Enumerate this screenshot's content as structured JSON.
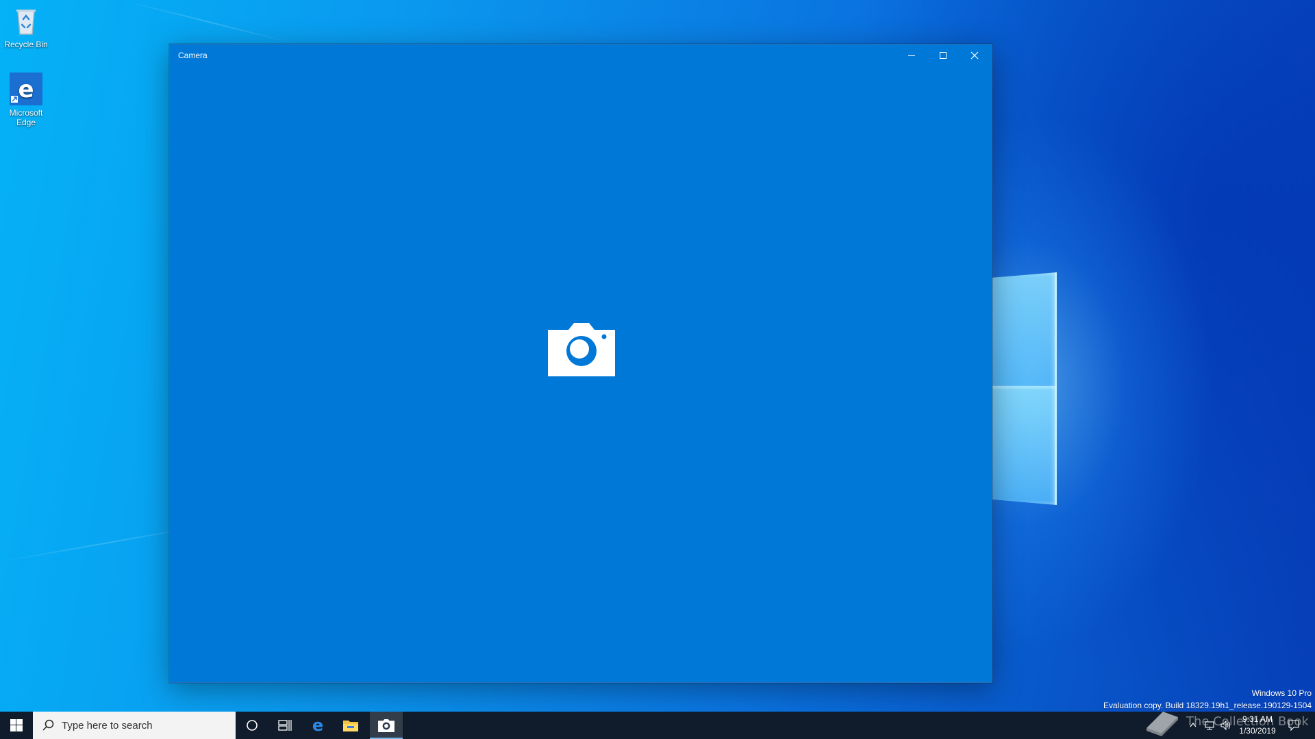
{
  "desktop": {
    "icons": [
      {
        "label": "Recycle Bin",
        "icon": "recycle-bin-icon"
      },
      {
        "label": "Microsoft Edge",
        "icon": "edge-icon"
      }
    ],
    "edition": "Windows 10 Pro",
    "build": "Evaluation copy. Build 18329.19h1_release.190129-1504"
  },
  "window": {
    "title": "Camera",
    "accent": "#0078d7",
    "center_icon": "camera-icon",
    "controls": {
      "minimize": "minimize-icon",
      "maximize": "maximize-icon",
      "close": "close-icon"
    }
  },
  "taskbar": {
    "search_placeholder": "Type here to search",
    "pinned": [
      "cortana-icon",
      "task-view-icon",
      "edge-icon",
      "file-explorer-icon",
      "camera-icon"
    ],
    "active_app": "Camera",
    "tray": [
      "chevron-up-icon",
      "network-icon",
      "volume-icon"
    ],
    "time": "9:31 AM",
    "date": "1/30/2019",
    "watermark": "The Collection Book"
  }
}
